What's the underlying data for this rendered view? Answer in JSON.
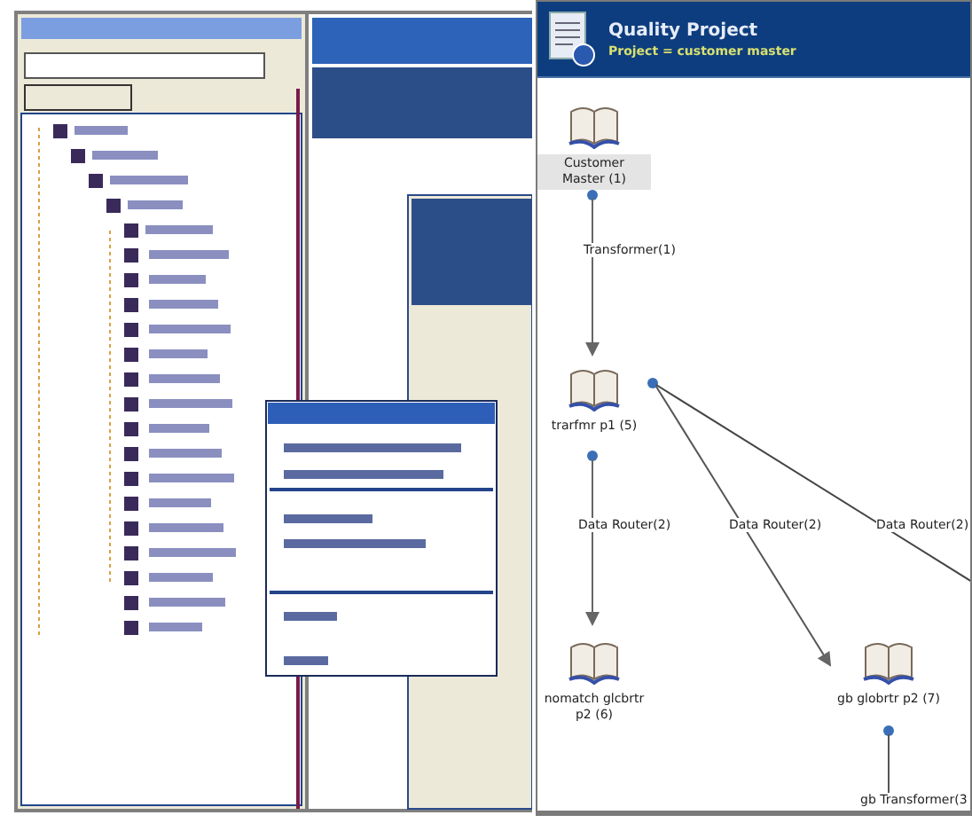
{
  "project_panel": {
    "title": "Quality Project",
    "subtitle": "Project = customer master"
  },
  "diagram": {
    "nodes": [
      {
        "label": "Customer Master (1)",
        "highlighted": true
      },
      {
        "label": "trarfmr p1 (5)",
        "highlighted": false
      },
      {
        "label": "nomatch glcbrtr p2 (6)",
        "highlighted": false
      },
      {
        "label": "gb globrtr p2 (7)",
        "highlighted": false
      }
    ],
    "edges": [
      {
        "label": "Transformer(1)"
      },
      {
        "label": "Data Router(2)"
      },
      {
        "label": "Data Router(2)"
      },
      {
        "label": "Data Router(2)"
      },
      {
        "label": "gb Transformer(3"
      }
    ]
  }
}
